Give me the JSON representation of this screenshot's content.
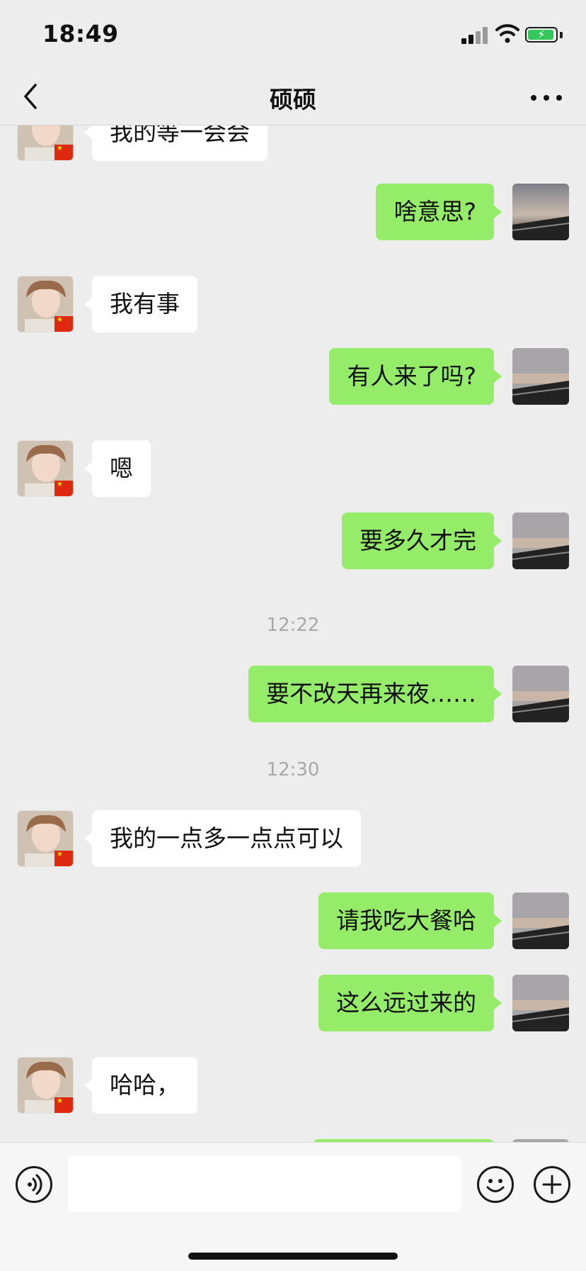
{
  "status_bar": {
    "time": "18:49"
  },
  "nav": {
    "title": "硕硕"
  },
  "messages": [
    {
      "side": "left",
      "text": "我的等一会会"
    },
    {
      "side": "right",
      "text": "啥意思?"
    },
    {
      "side": "left",
      "text": "我有事"
    },
    {
      "side": "right",
      "text": "有人来了吗?"
    },
    {
      "side": "left",
      "text": "嗯"
    },
    {
      "side": "right",
      "text": "要多久才完"
    },
    {
      "timestamp": "12:22"
    },
    {
      "side": "right",
      "text": "要不改天再来夜……"
    },
    {
      "timestamp": "12:30"
    },
    {
      "side": "left",
      "text": "我的一点多一点点可以"
    },
    {
      "side": "right",
      "text": "请我吃大餐哈"
    },
    {
      "side": "right",
      "text": "这么远过来的"
    },
    {
      "side": "left",
      "text": "哈哈，"
    }
  ],
  "input": {
    "value": ""
  },
  "icons": {
    "back": "chevron-left-icon",
    "more": "more-dots-icon",
    "voice": "voice-icon",
    "emoji": "emoji-icon",
    "plus": "plus-icon"
  },
  "colors": {
    "background": "#ededed",
    "sent_bubble": "#95ec69",
    "received_bubble": "#ffffff",
    "timestamp": "#a8a8a8",
    "battery": "#34c759",
    "flag": "#de2910"
  }
}
